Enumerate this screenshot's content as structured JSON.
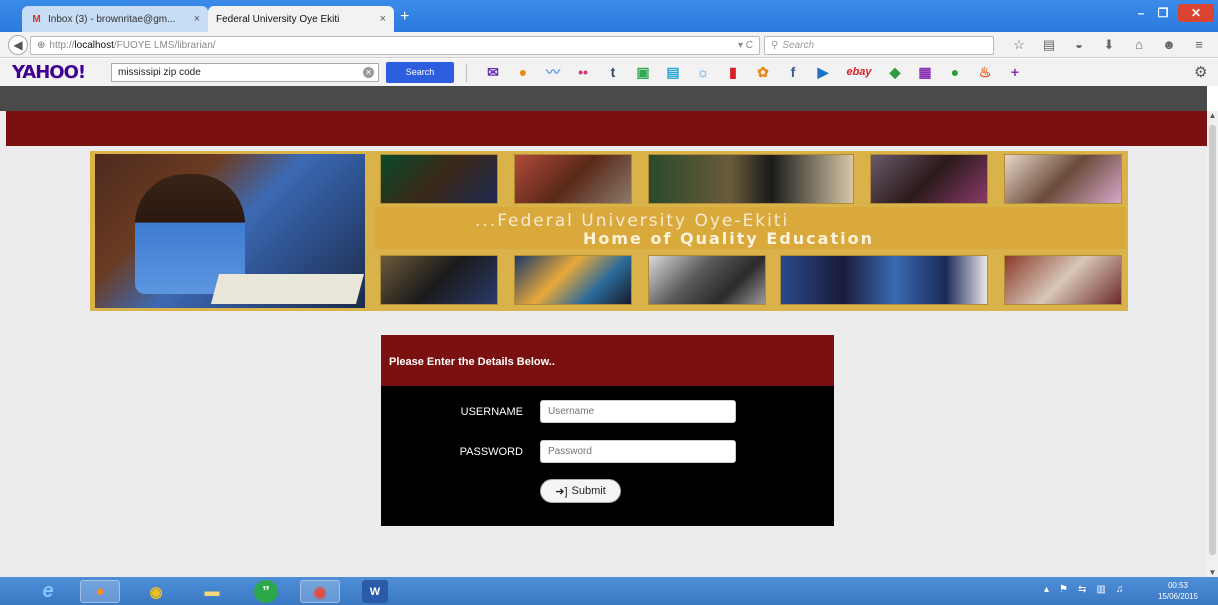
{
  "browser": {
    "tabs": [
      {
        "label": "Inbox (3) - brownritae@gm...",
        "icon": "gmail-icon",
        "close": "×"
      },
      {
        "label": "Federal University Oye Ekiti",
        "icon": "",
        "close": "×"
      }
    ],
    "new_tab": "+",
    "window_controls": {
      "minimize": "–",
      "maximize": "❐",
      "close": "✕"
    },
    "url": {
      "protocol": "http://",
      "host": "localhost",
      "path": "/FUOYE LMS/librarian/"
    },
    "search_placeholder": "Search",
    "nav_icons": [
      "star-icon",
      "reading-list-icon",
      "pocket-icon",
      "download-icon",
      "home-icon",
      "chat-icon",
      "menu-icon"
    ]
  },
  "yahoo_toolbar": {
    "logo": "YAHOO!",
    "search_value": "mississipi zip code",
    "search_button": "Search",
    "icons": [
      {
        "name": "mail-icon",
        "glyph": "✉",
        "color": "#6b2fb3"
      },
      {
        "name": "basketball-icon",
        "glyph": "●",
        "color": "#e88a1a"
      },
      {
        "name": "finance-icon",
        "glyph": "〰",
        "color": "#6aa3e8"
      },
      {
        "name": "flickr-icon",
        "glyph": "••",
        "color": "#d8307a"
      },
      {
        "name": "tumblr-icon",
        "glyph": "t",
        "color": "#2f4a6d"
      },
      {
        "name": "answers-icon",
        "glyph": "▣",
        "color": "#33a853"
      },
      {
        "name": "news-icon",
        "glyph": "▤",
        "color": "#28a8d8"
      },
      {
        "name": "weather-icon",
        "glyph": "☼",
        "color": "#3c8fd8"
      },
      {
        "name": "bookmark-icon",
        "glyph": "▮",
        "color": "#d8202a"
      },
      {
        "name": "flower-icon",
        "glyph": "✿",
        "color": "#e88a1a"
      },
      {
        "name": "facebook-icon",
        "glyph": "f",
        "color": "#3b5998"
      },
      {
        "name": "play-icon",
        "glyph": "▶",
        "color": "#1a73c8"
      },
      {
        "name": "ebay-icon",
        "glyph": "ebay",
        "color": "#d8202a"
      },
      {
        "name": "tag-icon",
        "glyph": "◆",
        "color": "#2a9d3a"
      },
      {
        "name": "movie-icon",
        "glyph": "▦",
        "color": "#8a2fb3"
      },
      {
        "name": "globe-icon",
        "glyph": "●",
        "color": "#2a9d3a"
      },
      {
        "name": "food-icon",
        "glyph": "♨",
        "color": "#e85a1a"
      },
      {
        "name": "add-icon",
        "glyph": "+",
        "color": "#8a2fb3"
      }
    ]
  },
  "page": {
    "banner": {
      "line1": "...Federal University Oye-Ekiti",
      "line2": "Home of Quality Education"
    },
    "login": {
      "heading": "Please Enter the Details Below..",
      "username_label": "USERNAME",
      "username_placeholder": "Username",
      "password_label": "PASSWORD",
      "password_placeholder": "Password",
      "submit_label": "Submit"
    }
  },
  "taskbar": {
    "apps": [
      "ie-icon",
      "firefox-icon",
      "chrome-icon",
      "folder-icon",
      "hangouts-icon",
      "chrome-icon-2",
      "word-icon"
    ],
    "time": "00:53",
    "date": "15/06/2015"
  }
}
